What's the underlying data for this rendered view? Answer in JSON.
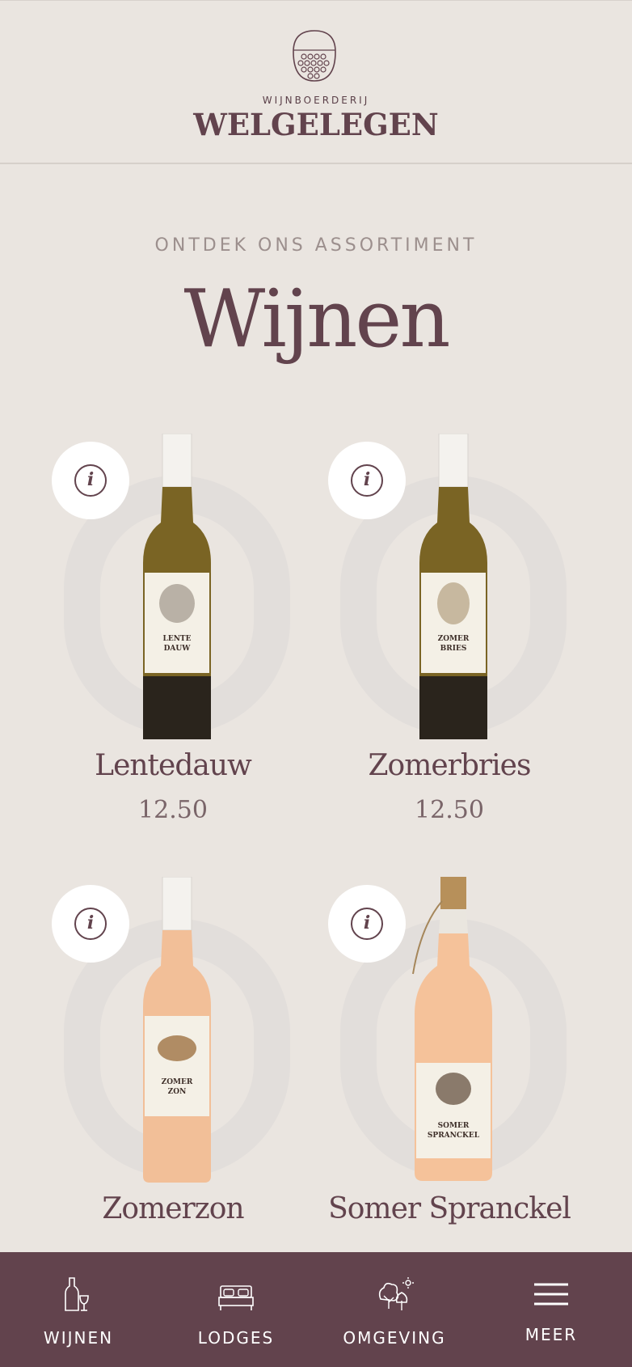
{
  "header": {
    "brand_small": "WIJNBOERDERIJ",
    "brand_big": "WELGELEGEN"
  },
  "main": {
    "eyebrow": "ONTDEK ONS ASSORTIMENT",
    "title": "Wijnen"
  },
  "products": [
    {
      "name": "Lentedauw",
      "price": "12.50",
      "label_line1": "LENTE",
      "label_line2": "DAUW",
      "wine_color": "#7a6424",
      "animal": "rooster"
    },
    {
      "name": "Zomerbries",
      "price": "12.50",
      "label_line1": "ZOMER",
      "label_line2": "BRIES",
      "wine_color": "#7a6424",
      "animal": "horse"
    },
    {
      "name": "Zomerzon",
      "label_line1": "ZOMER",
      "label_line2": "ZON",
      "wine_color": "#f2bf98",
      "animal": "duck"
    },
    {
      "name": "Somer Spranckel",
      "label_line1": "SOMER",
      "label_line2": "SPRANCKEL",
      "wine_color": "#f5c29a",
      "animal": "bull"
    }
  ],
  "bottom_nav": [
    {
      "label": "WIJNEN",
      "icon": "wine-bottle-icon"
    },
    {
      "label": "LODGES",
      "icon": "bed-icon"
    },
    {
      "label": "OMGEVING",
      "icon": "trees-icon"
    },
    {
      "label": "MEER",
      "icon": "menu-icon"
    }
  ],
  "colors": {
    "background": "#eae5e0",
    "brand": "#62434d",
    "ring": "#e2dedb",
    "nav_bg": "#62434d"
  }
}
